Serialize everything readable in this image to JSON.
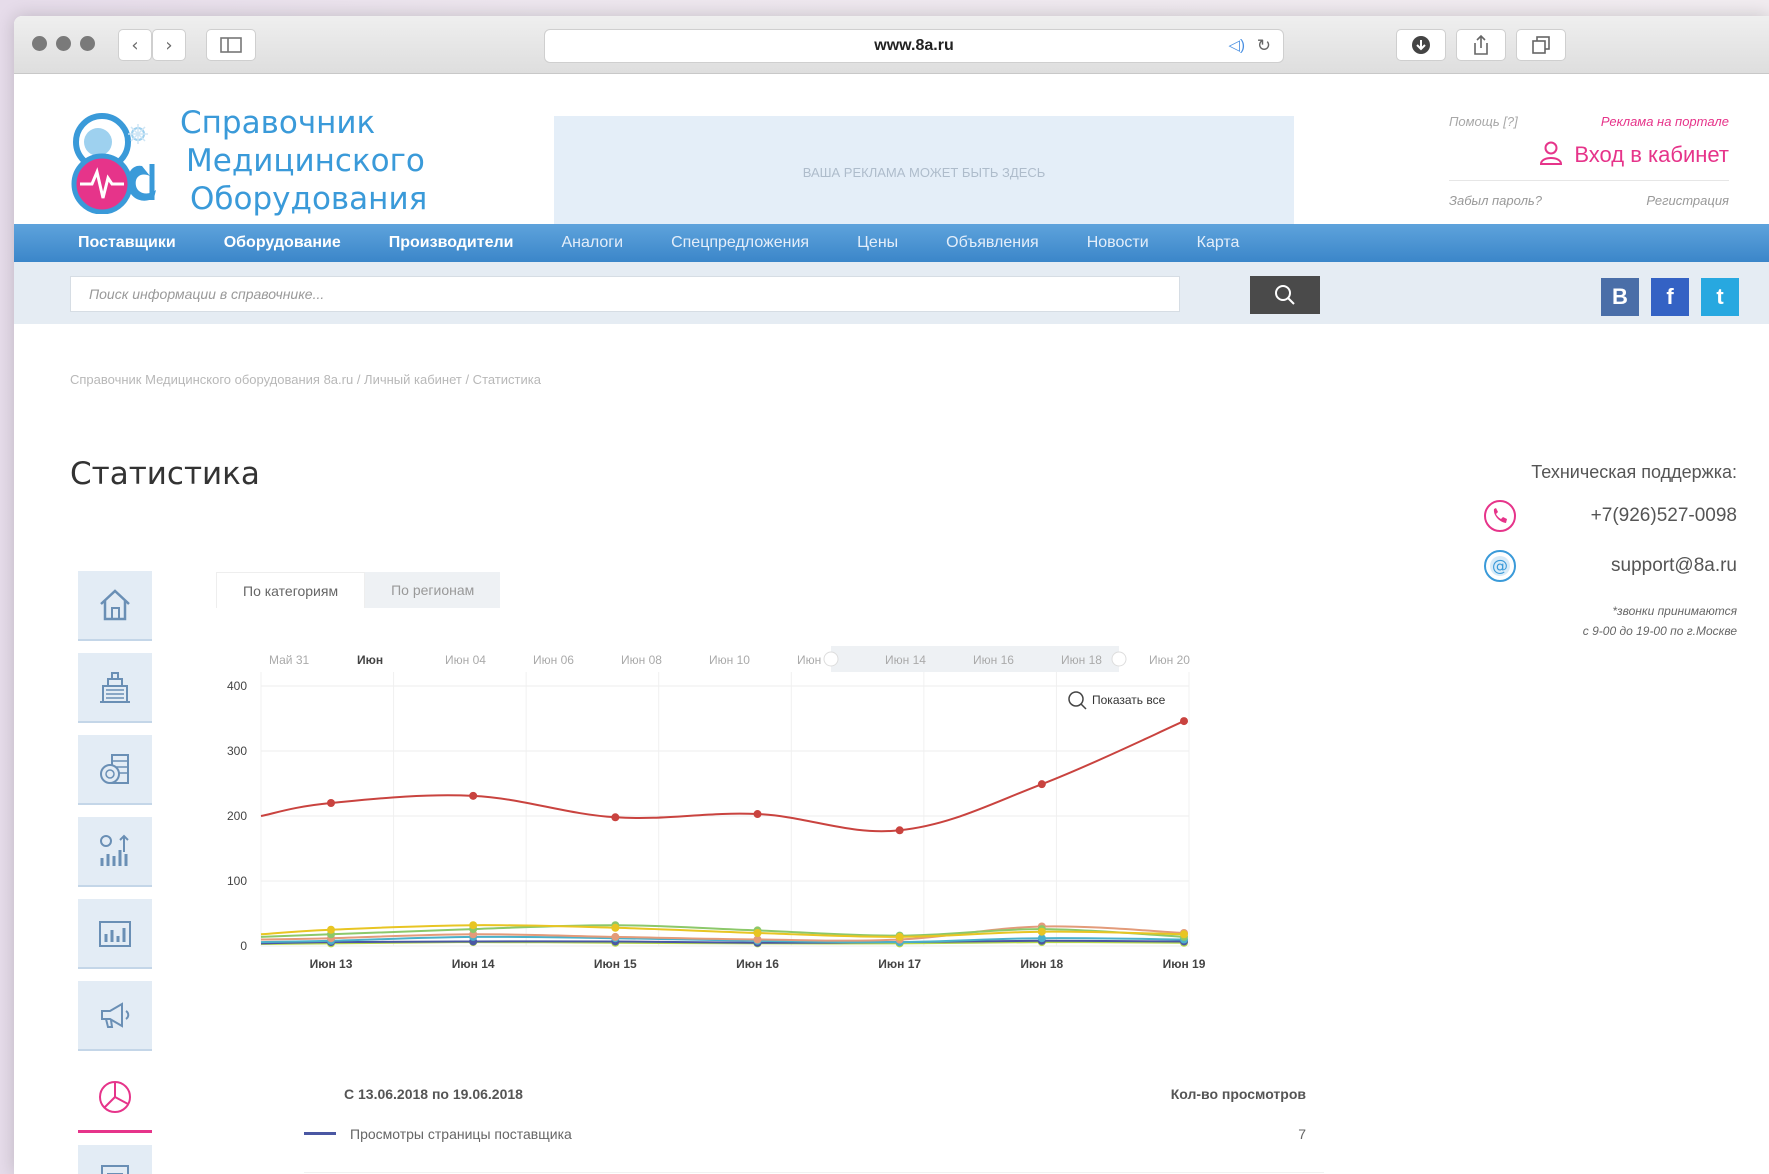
{
  "browser": {
    "url": "www.8a.ru"
  },
  "header": {
    "logo_lines": [
      "Справочник",
      "Медицинского",
      "Оборудования"
    ],
    "ad_text": "ВАША РЕКЛАМА МОЖЕТ БЫТЬ ЗДЕСЬ",
    "help_link": "Помощь [?]",
    "advert_link": "Реклама на портале",
    "login_label": "Вход в кабинет",
    "forgot_link": "Забыл пароль?",
    "register_link": "Регистрация"
  },
  "nav": {
    "items": [
      {
        "label": "Поставщики",
        "weight": "bold"
      },
      {
        "label": "Оборудование",
        "weight": "bold"
      },
      {
        "label": "Производители",
        "weight": "bold"
      },
      {
        "label": "Аналоги",
        "weight": "light"
      },
      {
        "label": "Спецпредложения",
        "weight": "light"
      },
      {
        "label": "Цены",
        "weight": "light"
      },
      {
        "label": "Объявления",
        "weight": "light"
      },
      {
        "label": "Новости",
        "weight": "light"
      },
      {
        "label": "Карта",
        "weight": "light"
      }
    ]
  },
  "search": {
    "placeholder": "Поиск информации в справочнике..."
  },
  "social": [
    "В",
    "f",
    "t"
  ],
  "breadcrumb": "Справочник Медицинского оборудования 8a.ru / Личный кабинет / Статистика",
  "page": {
    "title": "Статистика"
  },
  "support": {
    "title": "Техническая поддержка:",
    "phone": "+7(926)527-0098",
    "email": "support@8a.ru",
    "note_line1": "*звонки принимаются",
    "note_line2": "с 9-00 до 19-00 по г.Москве"
  },
  "tabs": [
    {
      "label": "По категориям",
      "active": true
    },
    {
      "label": "По регионам",
      "active": false
    }
  ],
  "chart_zoom_label": "Показать все",
  "chart_data": {
    "type": "line",
    "x": [
      "Июн 13",
      "Июн 14",
      "Июн 15",
      "Июн 16",
      "Июн 17",
      "Июн 18",
      "Июн 19"
    ],
    "navigator_labels": [
      "Май 31",
      "Июн",
      "Июн 04",
      "Июн 06",
      "Июн 08",
      "Июн 10",
      "Июн",
      "Июн 14",
      "Июн 16",
      "Июн 18",
      "Июн 20"
    ],
    "ylim": [
      0,
      400
    ],
    "yticks": [
      0,
      100,
      200,
      300,
      400
    ],
    "grid": true,
    "series": [
      {
        "color": "#c9433f",
        "values": [
          220,
          231,
          198,
          203,
          178,
          249,
          346
        ],
        "start": 200
      },
      {
        "color": "#e8c523",
        "values": [
          25,
          32,
          28,
          20,
          14,
          22,
          18
        ],
        "start": 18
      },
      {
        "color": "#8cc86a",
        "values": [
          18,
          26,
          32,
          24,
          16,
          26,
          14
        ],
        "start": 14
      },
      {
        "color": "#e39b7a",
        "values": [
          12,
          18,
          14,
          10,
          10,
          30,
          20
        ],
        "start": 10
      },
      {
        "color": "#4bb0c9",
        "values": [
          8,
          14,
          12,
          8,
          6,
          12,
          10
        ],
        "start": 6
      },
      {
        "color": "#4a57a3",
        "values": [
          6,
          7,
          7,
          5,
          6,
          8,
          7
        ],
        "start": 4
      },
      {
        "color": "#b4d84a",
        "values": [
          4,
          6,
          5,
          4,
          4,
          6,
          5
        ],
        "start": 3
      }
    ]
  },
  "table": {
    "header_left": "С 13.06.2018 по 19.06.2018",
    "header_right": "Кол-во просмотров",
    "rows": [
      {
        "label": "Просмотры страницы поставщика",
        "value": "7",
        "color": "#4a57a3"
      }
    ]
  }
}
